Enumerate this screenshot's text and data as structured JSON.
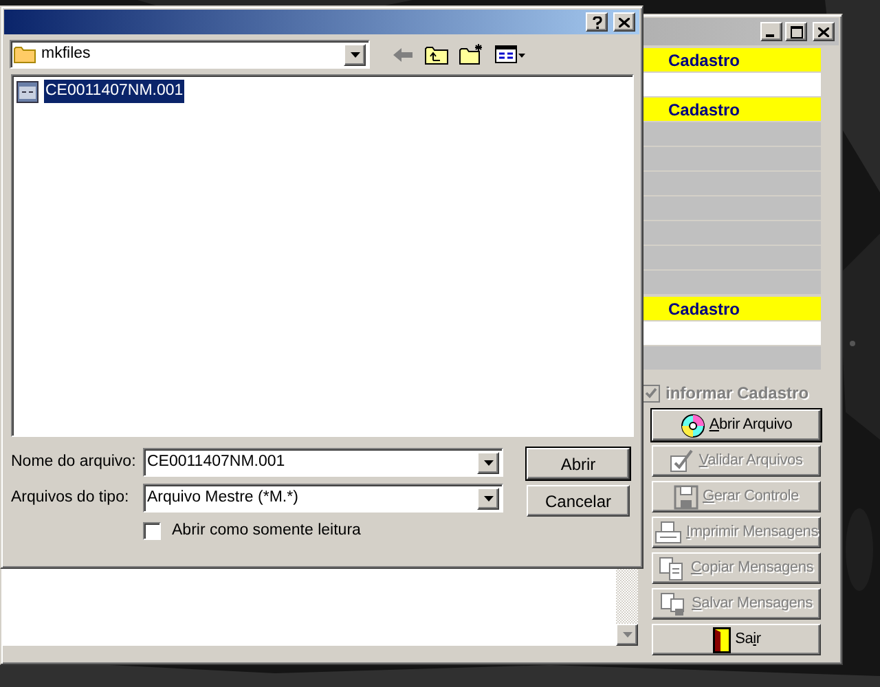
{
  "back_window": {
    "active": false,
    "rows": [
      {
        "kind": "yellow",
        "text": "Cadastro"
      },
      {
        "kind": "white"
      },
      {
        "kind": "yellow",
        "text": "Cadastro"
      },
      {
        "kind": "gray"
      },
      {
        "kind": "gray"
      },
      {
        "kind": "gray"
      },
      {
        "kind": "gray"
      },
      {
        "kind": "gray"
      },
      {
        "kind": "gray"
      },
      {
        "kind": "gray"
      },
      {
        "kind": "yellow",
        "text": "Cadastro"
      },
      {
        "kind": "white"
      },
      {
        "kind": "gray"
      }
    ],
    "option": {
      "label": "informar Cadastro",
      "checked": true,
      "disabled": true
    },
    "buttons": [
      {
        "kind": "disc",
        "key": "A",
        "post": "brir Arquivo",
        "disabled": false,
        "focused": true
      },
      {
        "kind": "check",
        "key": "V",
        "post": "alidar Arquivos",
        "disabled": true,
        "focused": false
      },
      {
        "kind": "floppy",
        "key": "G",
        "post": "erar Controle",
        "disabled": true,
        "focused": false
      },
      {
        "kind": "printer",
        "key": "I",
        "post": "mprimir Mensagens",
        "disabled": true,
        "focused": false
      },
      {
        "kind": "copy",
        "key": "C",
        "post": "opiar Mensagens",
        "disabled": true,
        "focused": false
      },
      {
        "kind": "save",
        "key": "S",
        "post": "alvar Mensagens",
        "disabled": true,
        "focused": false
      },
      {
        "kind": "door",
        "pre": "Sa",
        "key": "i",
        "post": "r",
        "disabled": false,
        "focused": false
      }
    ]
  },
  "dialog": {
    "active": true,
    "folder": {
      "value": "mkfiles"
    },
    "files": [
      {
        "name": "CE0011407NM.001",
        "selected": true
      }
    ],
    "file_name": {
      "label": "Nome do arquivo:",
      "value": "CE0011407NM.001"
    },
    "file_type": {
      "label": "Arquivos do tipo:",
      "value": "Arquivo Mestre (*M.*)"
    },
    "buttons": [
      {
        "label": "Abrir",
        "default": true
      },
      {
        "label": "Cancelar",
        "default": false
      }
    ],
    "read_only": {
      "label": "Abrir como somente leitura",
      "checked": false
    }
  }
}
